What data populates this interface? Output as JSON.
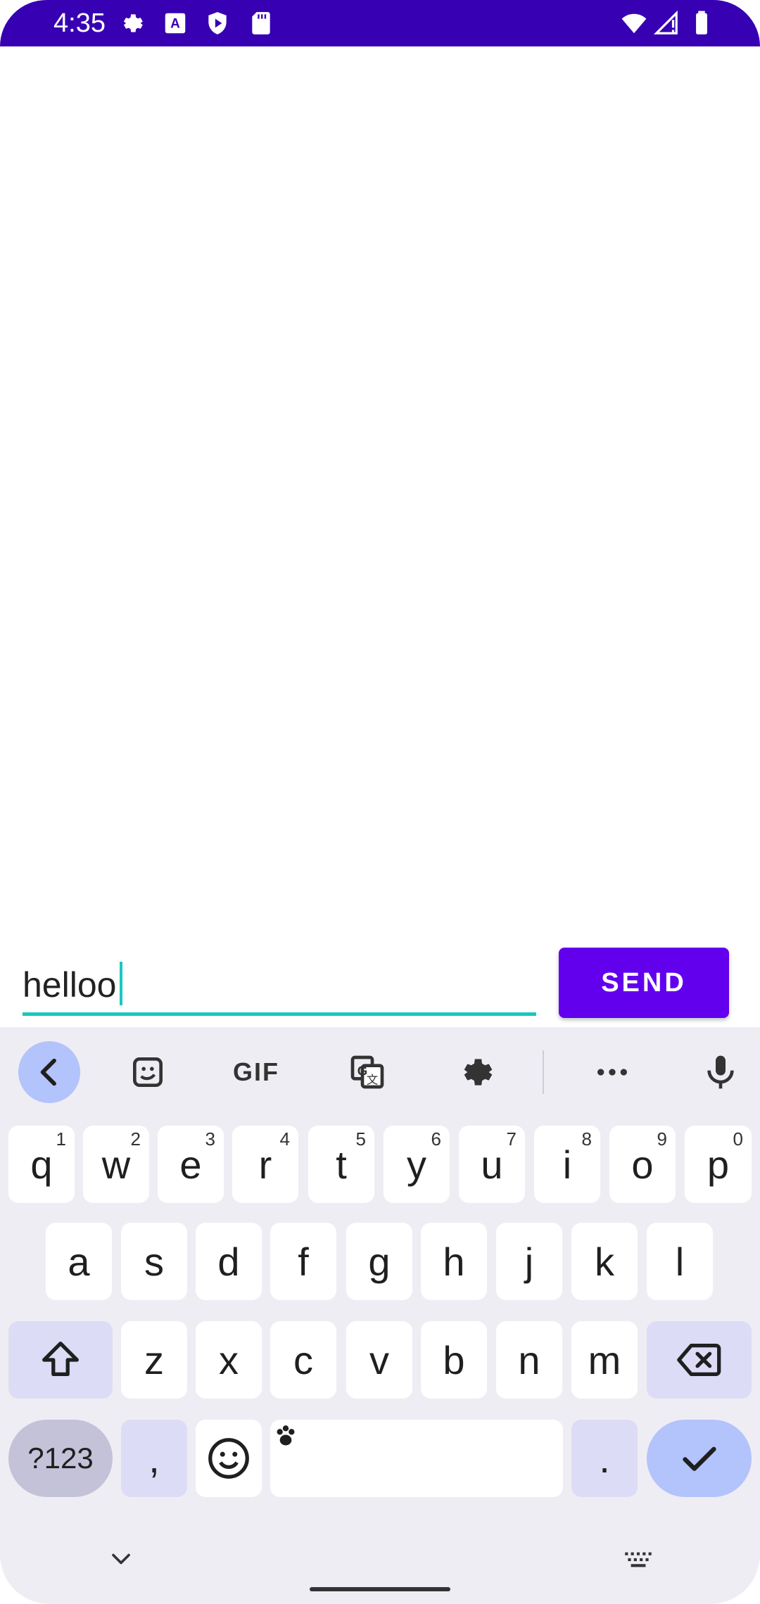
{
  "status_bar": {
    "time": "4:35",
    "color": "#3700b3"
  },
  "message": {
    "value": "helloo",
    "send_label": "SEND"
  },
  "keyboard_toolbar": {
    "items": [
      "back-icon",
      "sticker-icon",
      "gif-icon",
      "translate-icon",
      "settings-icon",
      "more-icon",
      "microphone-icon"
    ],
    "gif_label": "GIF"
  },
  "keyboard": {
    "row1": [
      {
        "key": "q",
        "hint": "1"
      },
      {
        "key": "w",
        "hint": "2"
      },
      {
        "key": "e",
        "hint": "3"
      },
      {
        "key": "r",
        "hint": "4"
      },
      {
        "key": "t",
        "hint": "5"
      },
      {
        "key": "y",
        "hint": "6"
      },
      {
        "key": "u",
        "hint": "7"
      },
      {
        "key": "i",
        "hint": "8"
      },
      {
        "key": "o",
        "hint": "9"
      },
      {
        "key": "p",
        "hint": "0"
      }
    ],
    "row2": [
      "a",
      "s",
      "d",
      "f",
      "g",
      "h",
      "j",
      "k",
      "l"
    ],
    "row3": [
      "z",
      "x",
      "c",
      "v",
      "b",
      "n",
      "m"
    ],
    "symbols_label": "?123",
    "comma": ",",
    "period": "."
  },
  "colors": {
    "accent": "#6200ee",
    "input_underline": "#18c8c0",
    "keyboard_bg": "#efedf4"
  }
}
